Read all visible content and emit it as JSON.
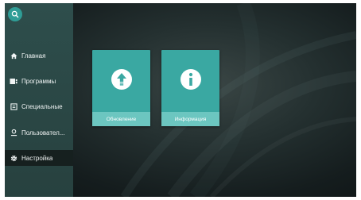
{
  "search": {
    "icon": "search-icon"
  },
  "sidebar": {
    "items": [
      {
        "label": "Главная",
        "icon": "home-icon"
      },
      {
        "label": "Программы",
        "icon": "apps-icon"
      },
      {
        "label": "Специальные",
        "icon": "special-icon"
      },
      {
        "label": "Пользовател...",
        "icon": "user-icon"
      },
      {
        "label": "Настройка",
        "icon": "gear-icon",
        "active": true
      }
    ]
  },
  "tiles": [
    {
      "label": "Обновление",
      "icon": "update-arrow-icon"
    },
    {
      "label": "Информация",
      "icon": "info-icon"
    }
  ],
  "colors": {
    "accent": "#3aa8a2",
    "tile_label_bg": "#6cc6c0",
    "sidebar_bg": "#2e4e4c",
    "active_item_bg": "#16201f"
  }
}
